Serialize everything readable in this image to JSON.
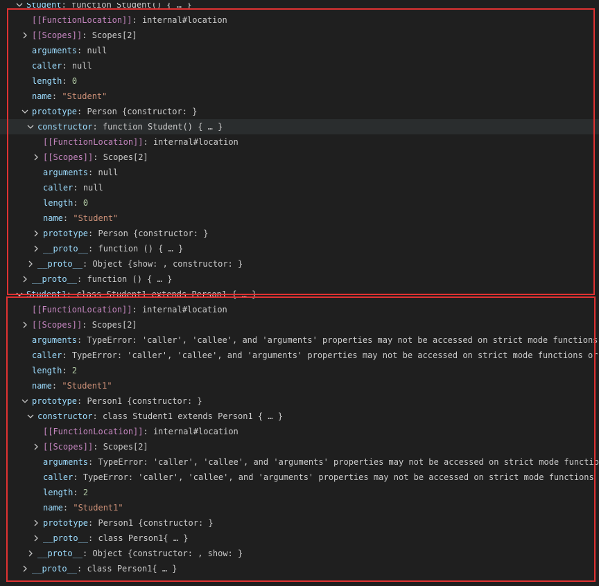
{
  "rows": [
    {
      "indent": 0,
      "toggle": "expanded",
      "key": "Student",
      "key_class": "kg",
      "value": "function Student() { … }",
      "value_class": "v",
      "highlight": false
    },
    {
      "indent": 1,
      "toggle": "none",
      "key": "[[FunctionLocation]]",
      "key_class": "k",
      "value": "internal#location",
      "value_class": "v",
      "highlight": false
    },
    {
      "indent": 1,
      "toggle": "collapsed",
      "key": "[[Scopes]]",
      "key_class": "k",
      "value": "Scopes[2]",
      "value_class": "v",
      "highlight": false
    },
    {
      "indent": 1,
      "toggle": "none",
      "key": "arguments",
      "key_class": "kg",
      "value": "null",
      "value_class": "v",
      "highlight": false
    },
    {
      "indent": 1,
      "toggle": "none",
      "key": "caller",
      "key_class": "kg",
      "value": "null",
      "value_class": "v",
      "highlight": false
    },
    {
      "indent": 1,
      "toggle": "none",
      "key": "length",
      "key_class": "kg",
      "value": "0",
      "value_class": "n",
      "highlight": false
    },
    {
      "indent": 1,
      "toggle": "none",
      "key": "name",
      "key_class": "kg",
      "value": "\"Student\"",
      "value_class": "s",
      "highlight": false
    },
    {
      "indent": 1,
      "toggle": "expanded",
      "key": "prototype",
      "key_class": "kg",
      "value": "Person {constructor: }",
      "value_class": "v",
      "highlight": false
    },
    {
      "indent": 2,
      "toggle": "expanded",
      "key": "constructor",
      "key_class": "kg",
      "value": "function Student() { … }",
      "value_class": "v",
      "highlight": true
    },
    {
      "indent": 3,
      "toggle": "none",
      "key": "[[FunctionLocation]]",
      "key_class": "k",
      "value": "internal#location",
      "value_class": "v",
      "highlight": false
    },
    {
      "indent": 3,
      "toggle": "collapsed",
      "key": "[[Scopes]]",
      "key_class": "k",
      "value": "Scopes[2]",
      "value_class": "v",
      "highlight": false
    },
    {
      "indent": 3,
      "toggle": "none",
      "key": "arguments",
      "key_class": "kg",
      "value": "null",
      "value_class": "v",
      "highlight": false
    },
    {
      "indent": 3,
      "toggle": "none",
      "key": "caller",
      "key_class": "kg",
      "value": "null",
      "value_class": "v",
      "highlight": false
    },
    {
      "indent": 3,
      "toggle": "none",
      "key": "length",
      "key_class": "kg",
      "value": "0",
      "value_class": "n",
      "highlight": false
    },
    {
      "indent": 3,
      "toggle": "none",
      "key": "name",
      "key_class": "kg",
      "value": "\"Student\"",
      "value_class": "s",
      "highlight": false
    },
    {
      "indent": 3,
      "toggle": "collapsed",
      "key": "prototype",
      "key_class": "kg",
      "value": "Person {constructor: }",
      "value_class": "v",
      "highlight": false
    },
    {
      "indent": 3,
      "toggle": "collapsed",
      "key": "__proto__",
      "key_class": "kg",
      "value": "function () { … }",
      "value_class": "v",
      "highlight": false
    },
    {
      "indent": 2,
      "toggle": "collapsed",
      "key": "__proto__",
      "key_class": "kg",
      "value": "Object {show: , constructor: }",
      "value_class": "v",
      "highlight": false
    },
    {
      "indent": 1,
      "toggle": "collapsed",
      "key": "__proto__",
      "key_class": "kg",
      "value": "function () { … }",
      "value_class": "v",
      "highlight": false
    },
    {
      "indent": 0,
      "toggle": "expanded",
      "key": "Student1",
      "key_class": "kg",
      "value": "class Student1 extends Person1 { … }",
      "value_class": "v",
      "highlight": false
    },
    {
      "indent": 1,
      "toggle": "none",
      "key": "[[FunctionLocation]]",
      "key_class": "k",
      "value": "internal#location",
      "value_class": "v",
      "highlight": false
    },
    {
      "indent": 1,
      "toggle": "collapsed",
      "key": "[[Scopes]]",
      "key_class": "k",
      "value": "Scopes[2]",
      "value_class": "v",
      "highlight": false
    },
    {
      "indent": 1,
      "toggle": "none",
      "key": "arguments",
      "key_class": "kg",
      "value": "TypeError: 'caller', 'callee', and 'arguments' properties may not be accessed on strict mode functions …",
      "value_class": "v",
      "highlight": false
    },
    {
      "indent": 1,
      "toggle": "none",
      "key": "caller",
      "key_class": "kg",
      "value": "TypeError: 'caller', 'callee', and 'arguments' properties may not be accessed on strict mode functions or …",
      "value_class": "v",
      "highlight": false
    },
    {
      "indent": 1,
      "toggle": "none",
      "key": "length",
      "key_class": "kg",
      "value": "2",
      "value_class": "n",
      "highlight": false
    },
    {
      "indent": 1,
      "toggle": "none",
      "key": "name",
      "key_class": "kg",
      "value": "\"Student1\"",
      "value_class": "s",
      "highlight": false
    },
    {
      "indent": 1,
      "toggle": "expanded",
      "key": "prototype",
      "key_class": "kg",
      "value": "Person1 {constructor: }",
      "value_class": "v",
      "highlight": false
    },
    {
      "indent": 2,
      "toggle": "expanded",
      "key": "constructor",
      "key_class": "kg",
      "value": "class Student1 extends Person1 { … }",
      "value_class": "v",
      "highlight": false
    },
    {
      "indent": 3,
      "toggle": "none",
      "key": "[[FunctionLocation]]",
      "key_class": "k",
      "value": "internal#location",
      "value_class": "v",
      "highlight": false
    },
    {
      "indent": 3,
      "toggle": "collapsed",
      "key": "[[Scopes]]",
      "key_class": "k",
      "value": "Scopes[2]",
      "value_class": "v",
      "highlight": false
    },
    {
      "indent": 3,
      "toggle": "none",
      "key": "arguments",
      "key_class": "kg",
      "value": "TypeError: 'caller', 'callee', and 'arguments' properties may not be accessed on strict mode function…",
      "value_class": "v",
      "highlight": false
    },
    {
      "indent": 3,
      "toggle": "none",
      "key": "caller",
      "key_class": "kg",
      "value": "TypeError: 'caller', 'callee', and 'arguments' properties may not be accessed on strict mode functions o…",
      "value_class": "v",
      "highlight": false
    },
    {
      "indent": 3,
      "toggle": "none",
      "key": "length",
      "key_class": "kg",
      "value": "2",
      "value_class": "n",
      "highlight": false
    },
    {
      "indent": 3,
      "toggle": "none",
      "key": "name",
      "key_class": "kg",
      "value": "\"Student1\"",
      "value_class": "s",
      "highlight": false
    },
    {
      "indent": 3,
      "toggle": "collapsed",
      "key": "prototype",
      "key_class": "kg",
      "value": "Person1 {constructor: }",
      "value_class": "v",
      "highlight": false
    },
    {
      "indent": 3,
      "toggle": "collapsed",
      "key": "__proto__",
      "key_class": "kg",
      "value": "class Person1{ … }",
      "value_class": "v",
      "highlight": false
    },
    {
      "indent": 2,
      "toggle": "collapsed",
      "key": "__proto__",
      "key_class": "kg",
      "value": "Object {constructor: , show: }",
      "value_class": "v",
      "highlight": false
    },
    {
      "indent": 1,
      "toggle": "collapsed",
      "key": "__proto__",
      "key_class": "kg",
      "value": "class Person1{ … }",
      "value_class": "v",
      "highlight": false
    }
  ],
  "annotations": {
    "box_1_label": "Student",
    "box_2_label": "Student1",
    "color": "#e03232"
  },
  "colors": {
    "background": "#1f1f1f",
    "internal_key": "#c586c0",
    "property_key": "#9cdcfe",
    "string": "#ce9178",
    "number": "#b5cea8",
    "text": "#cccccc",
    "row_highlight": "#2a2d2e"
  }
}
